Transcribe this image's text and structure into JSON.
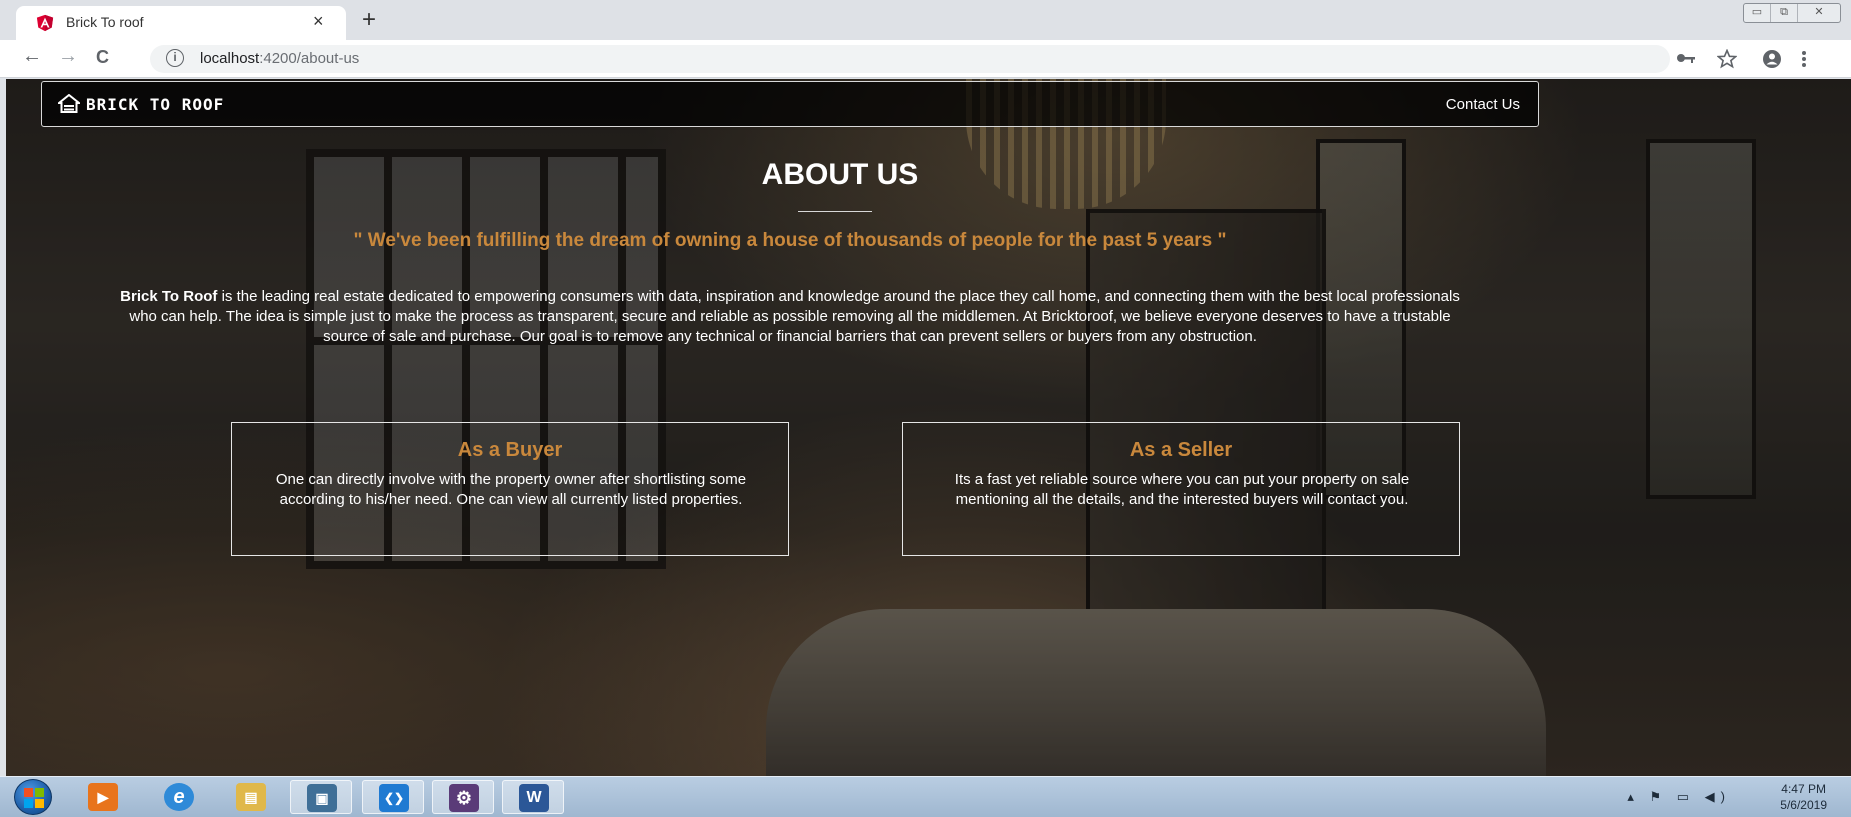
{
  "browser": {
    "tab_title": "Brick To roof",
    "tab_close": "×",
    "new_tab": "+",
    "url_host": "localhost",
    "url_rest": ":4200/about-us",
    "window_buttons": [
      "▭",
      "⧉",
      "✕"
    ],
    "nav": {
      "back": "←",
      "forward": "→",
      "reload": "C"
    }
  },
  "site": {
    "brand": "BRICK TO ROOF",
    "contact": "Contact Us",
    "heading": "ABOUT US",
    "quote": "\" We've been fulfilling the dream of owning a house of thousands of people for the past 5 years \"",
    "intro_bold": "Brick To Roof",
    "intro_text": " is the leading real estate dedicated to empowering consumers with data, inspiration and knowledge around the place they call home, and connecting them with the best local professionals who can help. The idea is simple just to make the process as transparent, secure and reliable as possible removing all the middlemen. At Bricktoroof, we believe everyone deserves to have a trustable source of sale and purchase. Our goal is to remove any technical or financial barriers that can prevent sellers or buyers from any obstruction.",
    "cards": [
      {
        "title": "As a Buyer",
        "text": "One can directly involve with the property owner after shortlisting some according to his/her need. One can view all currently listed properties."
      },
      {
        "title": "As a Seller",
        "text": "Its a fast yet reliable source where you can put your property on sale mentioning all the details, and the interested buyers will contact you."
      }
    ],
    "accent_color": "#c9883c"
  },
  "taskbar": {
    "time": "4:47 PM",
    "date": "5/6/2019",
    "apps": [
      {
        "name": "media-player-icon",
        "glyph": "▶",
        "color": "#e8741c"
      },
      {
        "name": "internet-explorer-icon",
        "glyph": "e",
        "color": "#2e8ad8"
      },
      {
        "name": "file-explorer-icon",
        "glyph": "▤",
        "color": "#e0b84a"
      },
      {
        "name": "window-app-icon",
        "glyph": "▣",
        "color": "#3f6f97"
      },
      {
        "name": "vscode-icon",
        "glyph": "❮❯",
        "color": "#1f7ad2"
      },
      {
        "name": "java-ee-ide-icon",
        "glyph": "⚙",
        "color": "#5a3b78"
      },
      {
        "name": "word-icon",
        "glyph": "W",
        "color": "#2b5797"
      }
    ]
  }
}
